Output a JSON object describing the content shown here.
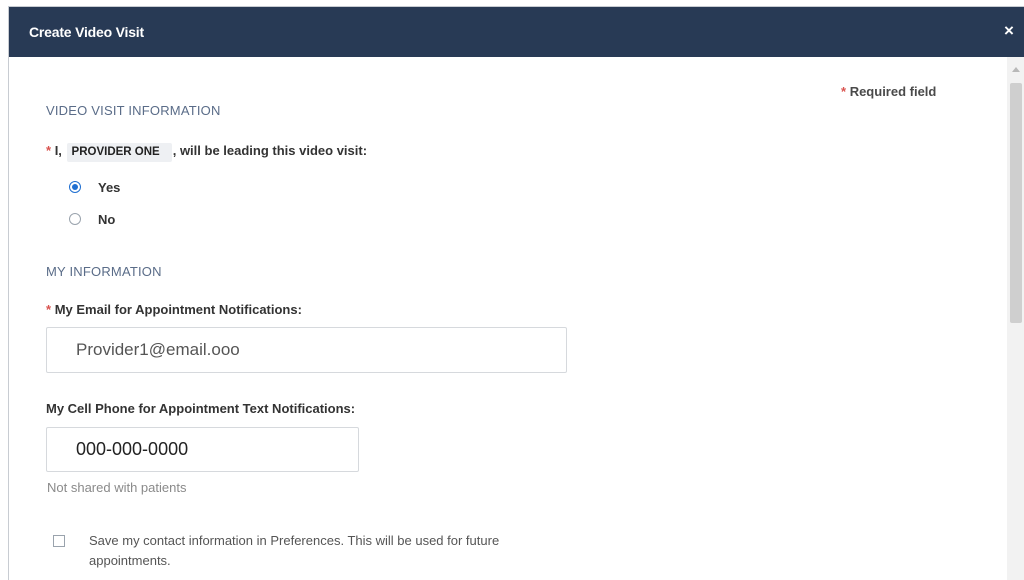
{
  "dialog": {
    "title": "Create Video Visit",
    "close_icon": "×"
  },
  "form": {
    "required_note": "Required field",
    "required_marker": "*",
    "video_section": {
      "header": "VIDEO VISIT INFORMATION",
      "leading_prefix": "I, ",
      "provider_name": "PROVIDER ONE",
      "leading_suffix": ", will be leading this video visit:",
      "options": [
        {
          "label": "Yes",
          "selected": true
        },
        {
          "label": "No",
          "selected": false
        }
      ]
    },
    "my_info_section": {
      "header": "MY INFORMATION",
      "email_label": "My Email for Appointment Notifications:",
      "email_value": "Provider1@email.ooo",
      "phone_label": "My Cell Phone for Appointment Text Notifications:",
      "phone_value": "000-000-0000",
      "phone_hint": "Not shared with patients",
      "save_checkbox_label": "Save my contact information in Preferences. This will be used for future appointments.",
      "save_checkbox_checked": false
    }
  },
  "colors": {
    "titlebar": "#283a55",
    "accent": "#1f6fd1",
    "required": "#d9534f"
  }
}
